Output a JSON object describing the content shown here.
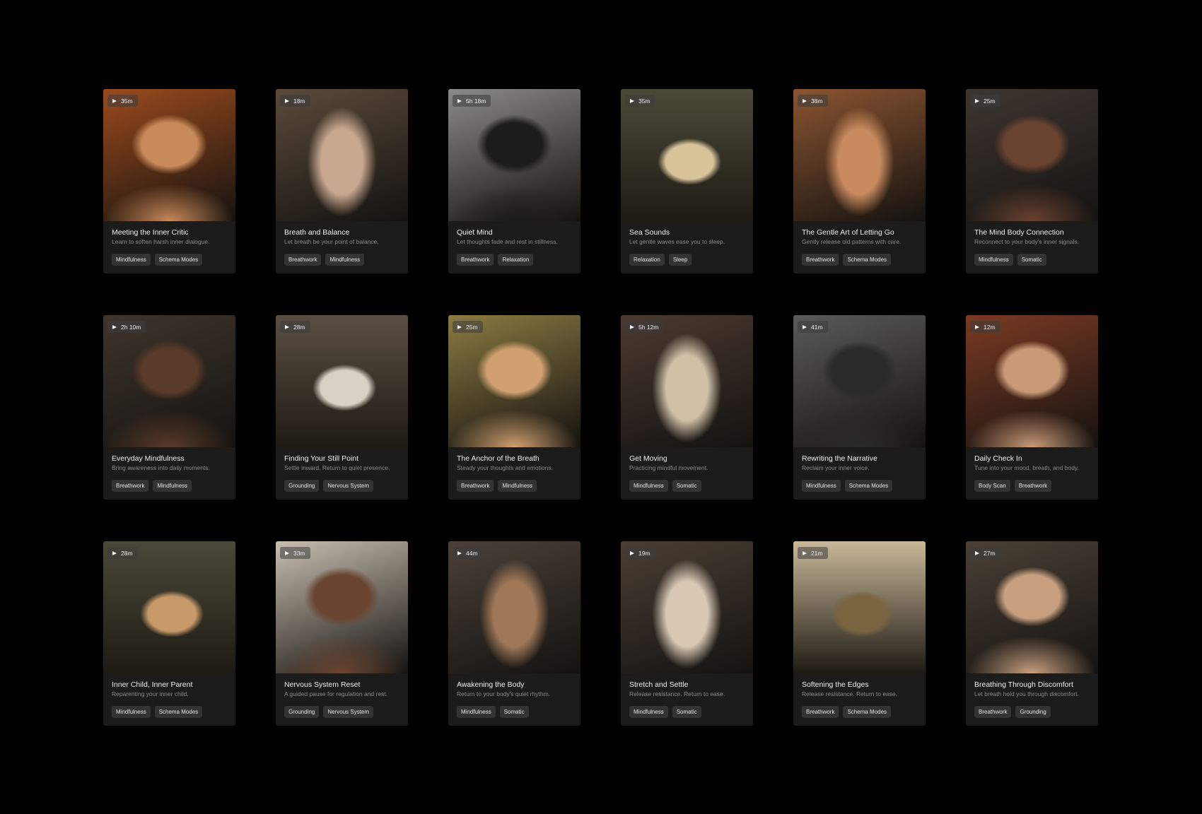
{
  "cards": [
    {
      "duration": "35m",
      "title": "Meeting the Inner Critic",
      "subtitle": "Learn to soften harsh inner dialogue.",
      "tags": [
        "Mindfulness",
        "Schema Modes"
      ],
      "bg": "#9a4a1c",
      "bg2": "#c88a5a",
      "subject": "portrait"
    },
    {
      "duration": "18m",
      "title": "Breath and Balance",
      "subtitle": "Let breath be your point of balance.",
      "tags": [
        "Breathwork",
        "Mindfulness"
      ],
      "bg": "#5a4a3a",
      "bg2": "#c9a890",
      "subject": "back-arms-raised"
    },
    {
      "duration": "5h 18m",
      "title": "Quiet Mind",
      "subtitle": "Let thoughts fade and rest in stillness.",
      "tags": [
        "Breathwork",
        "Relaxation"
      ],
      "bg": "#8a8a88",
      "bg2": "#1c1c1c",
      "subject": "head-profile"
    },
    {
      "duration": "35m",
      "title": "Sea Sounds",
      "subtitle": "Let gentle waves ease you to sleep.",
      "tags": [
        "Relaxation",
        "Sleep"
      ],
      "bg": "#4a4a38",
      "bg2": "#d8c39a",
      "subject": "shell"
    },
    {
      "duration": "38m",
      "title": "The Gentle Art of Letting Go",
      "subtitle": "Gently release old patterns with care.",
      "tags": [
        "Breathwork",
        "Schema Modes"
      ],
      "bg": "#8a5430",
      "bg2": "#c88a5e",
      "subject": "hands"
    },
    {
      "duration": "25m",
      "title": "The Mind Body Connection",
      "subtitle": "Reconnect to your body's inner signals.",
      "tags": [
        "Mindfulness",
        "Somatic"
      ],
      "bg": "#3e3630",
      "bg2": "#6a4230",
      "subject": "portrait-dark"
    },
    {
      "duration": "2h 10m",
      "title": "Everyday Mindfulness",
      "subtitle": "Bring awareness into daily moments.",
      "tags": [
        "Breathwork",
        "Mindfulness"
      ],
      "bg": "#3e352c",
      "bg2": "#5a3a28",
      "subject": "portrait-dark"
    },
    {
      "duration": "28m",
      "title": "Finding Your Still Point",
      "subtitle": "Settle inward. Return to quiet presence.",
      "tags": [
        "Grounding",
        "Nervous System"
      ],
      "bg": "#5a4e42",
      "bg2": "#d8d2c4",
      "subject": "stones"
    },
    {
      "duration": "25m",
      "title": "The Anchor of the Breath",
      "subtitle": "Steady your thoughts and emotions.",
      "tags": [
        "Breathwork",
        "Mindfulness"
      ],
      "bg": "#8a7a42",
      "bg2": "#d0a070",
      "subject": "profile-woman"
    },
    {
      "duration": "5h 12m",
      "title": "Get Moving",
      "subtitle": "Practicing mindful movement.",
      "tags": [
        "Mindfulness",
        "Somatic"
      ],
      "bg": "#4a3a30",
      "bg2": "#d0c0a8",
      "subject": "stretch"
    },
    {
      "duration": "41m",
      "title": "Rewriting the Narrative",
      "subtitle": "Reclaim your inner voice.",
      "tags": [
        "Mindfulness",
        "Schema Modes"
      ],
      "bg": "#5a5a5a",
      "bg2": "#2a2a2a",
      "subject": "head-closeup"
    },
    {
      "duration": "12m",
      "title": "Daily Check In",
      "subtitle": "Tune into your mood, breath, and body.",
      "tags": [
        "Body Scan",
        "Breathwork"
      ],
      "bg": "#7a3a22",
      "bg2": "#c89a78",
      "subject": "portrait-hair"
    },
    {
      "duration": "28m",
      "title": "Inner Child, Inner Parent",
      "subtitle": "Reparenting your inner child.",
      "tags": [
        "Mindfulness",
        "Schema Modes"
      ],
      "bg": "#4a4838",
      "bg2": "#c89a6a",
      "subject": "blocks"
    },
    {
      "duration": "33m",
      "title": "Nervous System Reset",
      "subtitle": "A guided pause for regulation and rest.",
      "tags": [
        "Grounding",
        "Nervous System"
      ],
      "bg": "#c8bfb0",
      "bg2": "#6a4430",
      "subject": "portrait-man"
    },
    {
      "duration": "44m",
      "title": "Awakening the Body",
      "subtitle": "Return to your body's quiet rhythm.",
      "tags": [
        "Mindfulness",
        "Somatic"
      ],
      "bg": "#4a4038",
      "bg2": "#a07858",
      "subject": "back-seated"
    },
    {
      "duration": "19m",
      "title": "Stretch and Settle",
      "subtitle": "Release resistance. Return to ease.",
      "tags": [
        "Mindfulness",
        "Somatic"
      ],
      "bg": "#4a3e34",
      "bg2": "#d8c8b4",
      "subject": "stretch-woman"
    },
    {
      "duration": "21m",
      "title": "Softening the Edges",
      "subtitle": "Release resistance. Return to ease.",
      "tags": [
        "Breathwork",
        "Schema Modes"
      ],
      "bg": "#c8b898",
      "bg2": "#7a6440",
      "subject": "spheres"
    },
    {
      "duration": "27m",
      "title": "Breathing Through Discomfort",
      "subtitle": "Let breath hold you through discomfort.",
      "tags": [
        "Breathwork",
        "Grounding"
      ],
      "bg": "#4a4036",
      "bg2": "#c8a080",
      "subject": "portrait-eyes-closed"
    }
  ]
}
